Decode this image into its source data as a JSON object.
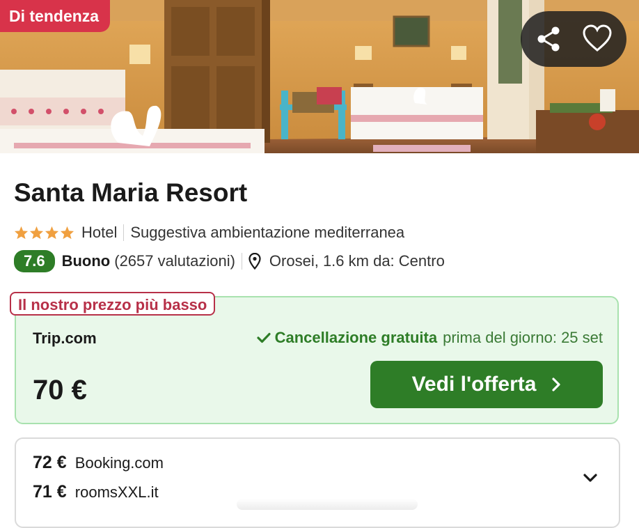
{
  "hero": {
    "badge": "Di tendenza",
    "icons": [
      "share-icon",
      "heart-icon"
    ]
  },
  "hotel": {
    "name": "Santa Maria Resort",
    "stars": 4,
    "type": "Hotel",
    "tagline": "Suggestiva ambientazione mediterranea",
    "score": "7.6",
    "rating_label": "Buono",
    "reviews": "(2657 valutazioni)",
    "location": "Orosei, 1.6 km da: Centro"
  },
  "best_offer": {
    "badge": "Il nostro prezzo più basso",
    "provider": "Trip.com",
    "cancel_bold": "Cancellazione gratuita",
    "cancel_rest": "prima del giorno: 25 set",
    "price": "70 €",
    "cta": "Vedi l'offerta"
  },
  "other_offers": [
    {
      "price": "72 €",
      "provider": "Booking.com"
    },
    {
      "price": "71 €",
      "provider": "roomsXXL.it"
    }
  ],
  "colors": {
    "brand_green": "#2e7d27",
    "badge_red": "#d8334a",
    "star": "#f0a040",
    "offer_bg": "#e9f8ea"
  }
}
